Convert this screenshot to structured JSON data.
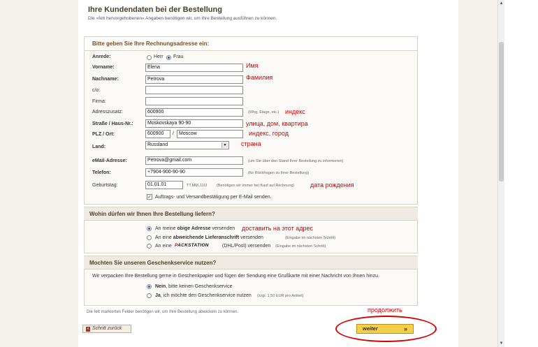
{
  "header": {
    "title": "Ihre Kundendaten bei der Bestellung",
    "note": "Die »fett hervorgehobenen« Angaben benötigen wir, um Ihre Bestellung ausführen zu können."
  },
  "billing": {
    "heading": "Bitte geben Sie Ihre Rechnungsadresse ein:",
    "anrede_label": "Anrede:",
    "anrede_options": [
      "Herr",
      "Frau"
    ],
    "anrede_selected": "Frau",
    "vorname_label": "Vorname:",
    "vorname_value": "Elena",
    "nachname_label": "Nachname:",
    "nachname_value": "Petrova",
    "co_label": "c/o:",
    "co_value": "",
    "firma_label": "Firma:",
    "firma_value": "",
    "adresszusatz_label": "Adresszusatz:",
    "adresszusatz_value": "600900",
    "adresszusatz_hint": "(Whg, Etage, etc.)",
    "strasse_label": "Straße / Haus-Nr.:",
    "strasse_value": "Moskovskaya 90-90",
    "plz_label": "PLZ / Ort:",
    "plz_value": "600900",
    "plz_separator": "/",
    "ort_value": "Moscow",
    "land_label": "Land:",
    "land_value": "Russland",
    "email_label": "eMail-Adresse:",
    "email_value": "Petrova@gmail.com",
    "email_hint": "(um Sie über den Stand Ihrer Bestellung zu informieren)",
    "telefon_label": "Telefon:",
    "telefon_value": "+7904-900-90-90",
    "telefon_hint": "(für Rückfragen zu Ihrer Bestellung)",
    "geburtstag_label": "Geburtstag:",
    "geburtstag_value": "01.01.01",
    "geburtstag_format": "TT.MM.JJJJ",
    "geburtstag_hint": "(Benötigen wir immer bei Kauf auf Rechnung)",
    "confirm_checkbox_label": "Auftrags- und Versandbestätigung per E-Mail senden.",
    "confirm_checked": true
  },
  "delivery": {
    "heading": "Wohin dürfen wir Ihnen Ihre Bestellung liefern?",
    "opt1_pre": "An meine ",
    "opt1_bold": "obige Adresse",
    "opt1_post": " versenden",
    "opt2_pre": "An eine ",
    "opt2_bold": "abweichende Lieferanschrift",
    "opt2_post": " versenden",
    "opt2_hint": "(Eingabe im nächsten Schritt)",
    "opt3_pre": "An eine",
    "opt3_brand_p": "P",
    "opt3_brand_rest": "ACKSTATION",
    "opt3_post": "(DHL/Post) versenden",
    "opt3_hint": "(Eingabe im nächsten Schritt)",
    "selected": 1
  },
  "gift": {
    "heading": "Mochten Sie unseren Geschenkservice nutzen?",
    "description": "Wir verpacken Ihre Bestellung gerne in Geschenkpapier und fügen der Sendung eine Grußkarte mit einer Nachricht von Ihnen hinzu.",
    "opt1_bold": "Nein",
    "opt1_post": ", bitte keinen Geschenkservice",
    "opt2_bold": "Ja",
    "opt2_post": ", ich möchte den Geschenkservice nutzen",
    "opt2_hint": "(zzgl. 1,50 EUR pro Artikel)",
    "selected": 1
  },
  "footer": {
    "note": "Die fett markierten Felder benötigen wir, um Ihre Bestellung abwickeln zu können.",
    "back_label": "Schritt zurück",
    "next_label": "weiter",
    "next_arrow": "»"
  },
  "annotations": {
    "vorname": "Имя",
    "nachname": "Фамилия",
    "adresszusatz": "индекс",
    "strasse": "улица, дом, квартира",
    "plz": "индекс, город",
    "land": "страна",
    "geburtstag": "дата рождения",
    "delivery": "доставить на этот адрес",
    "next": "продолжить"
  },
  "colors": {
    "annotation": "#d40000",
    "next_button": "#f3d04a",
    "heading": "#7a4a1a"
  }
}
